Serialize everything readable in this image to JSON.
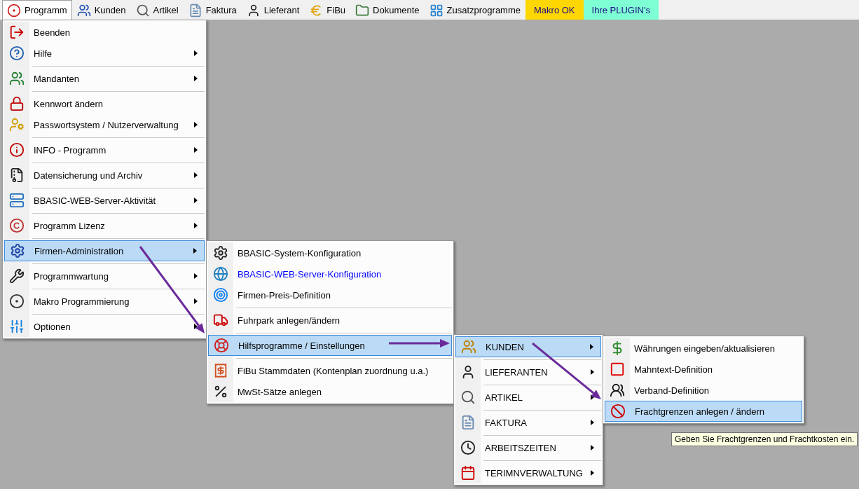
{
  "menubar": [
    {
      "label": "Programm",
      "selected": true,
      "kind": "icon"
    },
    {
      "label": "Kunden",
      "selected": false,
      "kind": "icon"
    },
    {
      "label": "Artikel",
      "selected": false,
      "kind": "icon"
    },
    {
      "label": "Faktura",
      "selected": false,
      "kind": "icon"
    },
    {
      "label": "Lieferant",
      "selected": false,
      "kind": "icon"
    },
    {
      "label": "FiBu",
      "selected": false,
      "kind": "icon"
    },
    {
      "label": "Dokumente",
      "selected": false,
      "kind": "icon"
    },
    {
      "label": "Zusatzprogramme",
      "selected": false,
      "kind": "icon"
    },
    {
      "label": "Makro OK",
      "selected": false,
      "kind": "colored",
      "color": "#ffd700"
    },
    {
      "label": "Ihre PLUGIN's",
      "selected": false,
      "kind": "colored",
      "color": "#7fffd4"
    }
  ],
  "menus": [
    {
      "items": [
        {
          "label": "Beenden",
          "submenu": false,
          "selected": false,
          "separator_before": false
        },
        {
          "label": "Hilfe",
          "submenu": true,
          "selected": false,
          "separator_before": false
        },
        {
          "label": "Mandanten",
          "submenu": true,
          "selected": false,
          "separator_before": true
        },
        {
          "label": "Kennwort ändern",
          "submenu": false,
          "selected": false,
          "separator_before": true
        },
        {
          "label": "Passwortsystem / Nutzerverwaltung",
          "submenu": true,
          "selected": false,
          "separator_before": false
        },
        {
          "label": "INFO - Programm",
          "submenu": true,
          "selected": false,
          "separator_before": true
        },
        {
          "label": "Datensicherung und Archiv",
          "submenu": true,
          "selected": false,
          "separator_before": true
        },
        {
          "label": "BBASIC-WEB-Server-Aktivität",
          "submenu": true,
          "selected": false,
          "separator_before": true
        },
        {
          "label": "Programm Lizenz",
          "submenu": true,
          "selected": false,
          "separator_before": true
        },
        {
          "label": "Firmen-Administration",
          "submenu": true,
          "selected": true,
          "separator_before": true
        },
        {
          "label": "Programmwartung",
          "submenu": true,
          "selected": false,
          "separator_before": true
        },
        {
          "label": "Makro Programmierung",
          "submenu": true,
          "selected": false,
          "separator_before": true
        },
        {
          "label": "Optionen",
          "submenu": true,
          "selected": false,
          "separator_before": true
        }
      ]
    },
    {
      "items": [
        {
          "label": "BBASIC-System-Konfiguration",
          "submenu": false,
          "selected": false,
          "separator_before": false,
          "color": "#000000"
        },
        {
          "label": "BBASIC-WEB-Server-Konfiguration",
          "submenu": false,
          "selected": false,
          "separator_before": false,
          "color": "#0000ff"
        },
        {
          "label": "Firmen-Preis-Definition",
          "submenu": false,
          "selected": false,
          "separator_before": false,
          "color": "#000000"
        },
        {
          "label": "Fuhrpark anlegen/ändern",
          "submenu": false,
          "selected": false,
          "separator_before": true,
          "color": "#000000"
        },
        {
          "label": "Hilfsprogramme / Einstellungen",
          "submenu": false,
          "selected": true,
          "separator_before": true,
          "color": "#000000"
        },
        {
          "label": "FiBu Stammdaten (Kontenplan zuordnung u.a.)",
          "submenu": false,
          "selected": false,
          "separator_before": true,
          "color": "#000000"
        },
        {
          "label": "MwSt-Sätze anlegen",
          "submenu": false,
          "selected": false,
          "separator_before": false,
          "color": "#000000"
        }
      ]
    },
    {
      "items": [
        {
          "label": "KUNDEN",
          "submenu": true,
          "selected": true,
          "separator_before": false
        },
        {
          "label": "LIEFERANTEN",
          "submenu": true,
          "selected": false,
          "separator_before": true
        },
        {
          "label": "ARTIKEL",
          "submenu": true,
          "selected": false,
          "separator_before": true
        },
        {
          "label": "FAKTURA",
          "submenu": true,
          "selected": false,
          "separator_before": true
        },
        {
          "label": "ARBEITSZEITEN",
          "submenu": true,
          "selected": false,
          "separator_before": true
        },
        {
          "label": "TERIMNVERWALTUNG",
          "submenu": true,
          "selected": false,
          "separator_before": true
        }
      ]
    },
    {
      "items": [
        {
          "label": "Währungen eingeben/aktualisieren",
          "submenu": false,
          "selected": false,
          "separator_before": false
        },
        {
          "label": "Mahntext-Definition",
          "submenu": false,
          "selected": false,
          "separator_before": false
        },
        {
          "label": "Verband-Definition",
          "submenu": false,
          "selected": false,
          "separator_before": false
        },
        {
          "label": "Frachtgrenzen anlegen / ändern",
          "submenu": false,
          "selected": true,
          "separator_before": false
        }
      ]
    }
  ],
  "tooltip": {
    "text": "Geben Sie Frachtgrenzen und  Frachtkosten ein."
  }
}
